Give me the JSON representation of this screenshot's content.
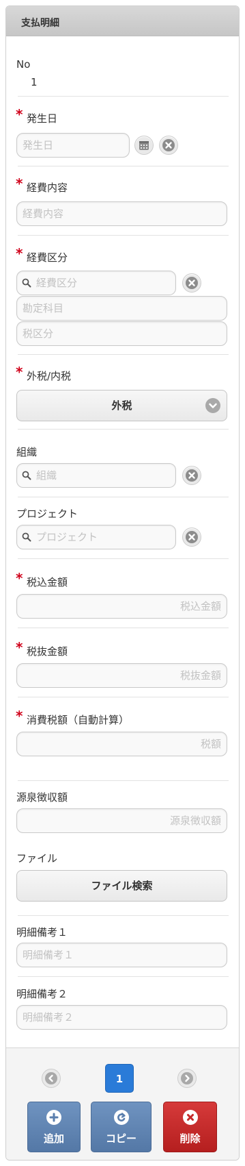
{
  "panel": {
    "title": "支払明細"
  },
  "no": {
    "label": "No",
    "value": "1"
  },
  "date": {
    "label": "発生日",
    "placeholder": "発生日"
  },
  "content": {
    "label": "経費内容",
    "placeholder": "経費内容"
  },
  "category": {
    "label": "経費区分",
    "placeholder": "経費区分",
    "account_placeholder": "勘定科目",
    "tax_category_placeholder": "税区分"
  },
  "tax_type": {
    "label": "外税/内税",
    "selected": "外税"
  },
  "organization": {
    "label": "組織",
    "placeholder": "組織"
  },
  "project": {
    "label": "プロジェクト",
    "placeholder": "プロジェクト"
  },
  "amount_incl_tax": {
    "label": "税込金額",
    "placeholder": "税込金額"
  },
  "amount_excl_tax": {
    "label": "税抜金額",
    "placeholder": "税抜金額"
  },
  "consumption_tax": {
    "label": "消費税額（自動計算）",
    "placeholder": "税額"
  },
  "withholding": {
    "label": "源泉徴収額",
    "placeholder": "源泉徴収額"
  },
  "file": {
    "label": "ファイル",
    "button": "ファイル検索"
  },
  "remarks1": {
    "label": "明細備考１",
    "placeholder": "明細備考１"
  },
  "remarks2": {
    "label": "明細備考２",
    "placeholder": "明細備考２"
  },
  "required_mark": "*",
  "pager": {
    "current": "1"
  },
  "actions": {
    "add": "追加",
    "copy": "コピー",
    "delete": "削除"
  },
  "colors": {
    "accent": "#2a7bd8",
    "action_blue": "#5f84b3",
    "action_red": "#c62828",
    "required": "#d0021b"
  },
  "icons": [
    "calendar-icon",
    "clear-icon",
    "search-icon",
    "chevron-down-icon",
    "prev-page-icon",
    "next-page-icon",
    "plus-icon",
    "copy-icon",
    "delete-icon"
  ]
}
